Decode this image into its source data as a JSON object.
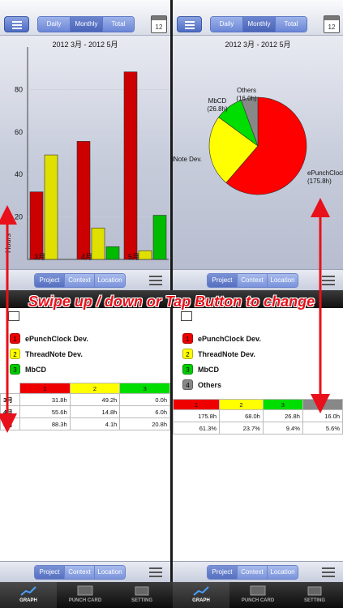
{
  "top_toolbar": {
    "segments": [
      "Daily",
      "Monthly",
      "Total"
    ],
    "selected": "Monthly",
    "calendar_day": "12"
  },
  "period_label": "2012 3月 - 2012 5月",
  "bottom_toolbar": {
    "segments": [
      "Project",
      "Context",
      "Location"
    ],
    "selected": "Project"
  },
  "bar_chart": {
    "chart_data": {
      "type": "bar",
      "categories": [
        "3月",
        "4月",
        "5月"
      ],
      "series": [
        {
          "name": "ePunchClock Dev.",
          "color": "#cc0000",
          "values": [
            31.8,
            55.6,
            88.3
          ]
        },
        {
          "name": "ThreadNote Dev.",
          "color": "#e0e000",
          "values": [
            49.2,
            14.8,
            4.1
          ]
        },
        {
          "name": "MbCD",
          "color": "#00bb00",
          "values": [
            0.0,
            6.0,
            20.8
          ]
        }
      ],
      "yticks": [
        "80",
        "60",
        "40",
        "20"
      ],
      "ylabel": "Hours",
      "ylim": [
        0,
        100
      ]
    }
  },
  "pie_chart": {
    "chart_data": {
      "type": "pie",
      "slices": [
        {
          "name": "ePunchClock",
          "value": 175.8,
          "label": "(175.8h)",
          "color": "#ff0000"
        },
        {
          "name": "ThreadNote Dev.",
          "value": 68.0,
          "label": "",
          "color": "#ffff00"
        },
        {
          "name": "MbCD",
          "value": 26.8,
          "label": "(26.8h)",
          "color": "#00dd00"
        },
        {
          "name": "Others",
          "value": 16.0,
          "label": "(16.0h)",
          "color": "#888888"
        }
      ]
    }
  },
  "pie_labels": {
    "epunch": "ePunchClock",
    "epunch_val": "(175.8h)",
    "thread": "ThreadNote Dev.",
    "mbcd": "MbCD",
    "mbcd_val": "(26.8h)",
    "others": "Others",
    "others_val": "(16.0h)"
  },
  "legend_left": [
    {
      "num": "1",
      "name": "ePunchClock Dev.",
      "color": "#ee0000"
    },
    {
      "num": "2",
      "name": "ThreadNote Dev.",
      "color": "#ffff00"
    },
    {
      "num": "3",
      "name": "MbCD",
      "color": "#00cc00"
    }
  ],
  "legend_right": [
    {
      "num": "1",
      "name": "ePunchClock Dev.",
      "color": "#ee0000"
    },
    {
      "num": "2",
      "name": "ThreadNote Dev.",
      "color": "#ffff00"
    },
    {
      "num": "3",
      "name": "MbCD",
      "color": "#00cc00"
    },
    {
      "num": "4",
      "name": "Others",
      "color": "#888888"
    }
  ],
  "table_left": {
    "headers": [
      "1",
      "2",
      "3"
    ],
    "rows": [
      {
        "label": "3月",
        "cells": [
          "31.8h",
          "49.2h",
          "0.0h"
        ]
      },
      {
        "label": "4月",
        "cells": [
          "55.6h",
          "14.8h",
          "6.0h"
        ]
      },
      {
        "label": "5月",
        "cells": [
          "88.3h",
          "4.1h",
          "20.8h"
        ]
      }
    ]
  },
  "table_right": {
    "headers": [
      "1",
      "2",
      "3",
      "4"
    ],
    "rows": [
      [
        "175.8h",
        "68.0h",
        "26.8h",
        "16.0h"
      ],
      [
        "61.3%",
        "23.7%",
        "9.4%",
        "5.6%"
      ]
    ]
  },
  "banner": "Swipe up / down or Tap Button to change",
  "tabs": [
    "GRAPH",
    "PUNCH CARD",
    "SETTING"
  ],
  "active_tab": "GRAPH"
}
